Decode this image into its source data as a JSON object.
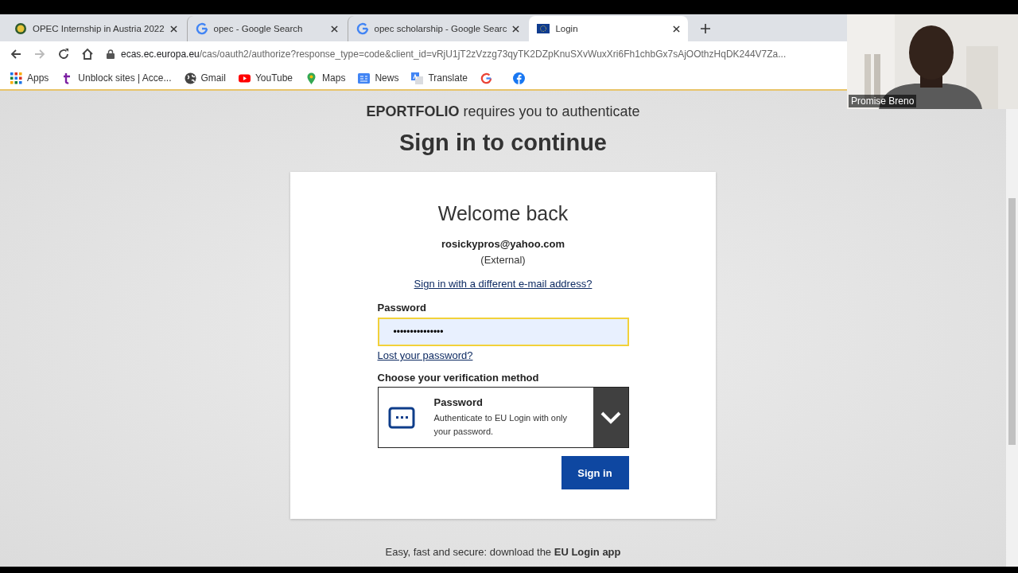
{
  "browser": {
    "tabs": [
      {
        "title": "OPEC Internship in Austria 2022",
        "selected": false
      },
      {
        "title": "opec - Google Search",
        "selected": false
      },
      {
        "title": "opec scholarship - Google Searc",
        "selected": false
      },
      {
        "title": "Login",
        "selected": true
      }
    ],
    "url_host": "ecas.ec.europa.eu",
    "url_path": "/cas/oauth2/authorize?response_type=code&client_id=vRjU1jT2zVzzg73qyTK2DZpKnuSXvWuxXri6Fh1chbGx7sAjOOthzHqDK244V7Za...",
    "bookmarks": [
      {
        "label": "Apps"
      },
      {
        "label": "Unblock sites | Acce..."
      },
      {
        "label": "Gmail"
      },
      {
        "label": "YouTube"
      },
      {
        "label": "Maps"
      },
      {
        "label": "News"
      },
      {
        "label": "Translate"
      }
    ]
  },
  "page": {
    "notice": "**EPORTFOLIO** requires you to authenticate",
    "heading": "Sign in to continue",
    "card": {
      "title": "Welcome back",
      "email": "rosickypros@yahoo.com",
      "account_type": "(External)",
      "switch_link": "Sign in with a different e-mail address?",
      "password_label": "Password",
      "password_value": "•••••••••••••••",
      "lost_link": "Lost your password?",
      "method_label": "Choose your verification method",
      "method": {
        "name": "Password",
        "description": "Authenticate to EU Login with only your password."
      },
      "submit": "Sign in"
    },
    "footer": "Easy, fast and secure: download the **EU Login app**"
  },
  "video": {
    "name": "Promise Breno"
  }
}
